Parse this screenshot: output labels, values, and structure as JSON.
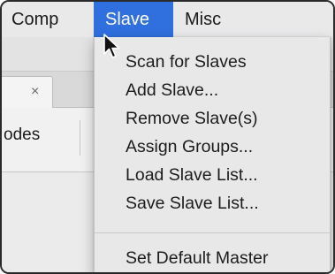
{
  "menubar": {
    "items": [
      {
        "label": "Comp"
      },
      {
        "label": "Slave",
        "active": true
      },
      {
        "label": "Misc"
      }
    ],
    "active_color": "#2f6fde"
  },
  "background": {
    "tab_close_glyph": "×",
    "nodes_label": "odes"
  },
  "dropdown": {
    "items": [
      {
        "label": "Scan for Slaves"
      },
      {
        "label": "Add Slave..."
      },
      {
        "label": "Remove Slave(s)"
      },
      {
        "label": "Assign Groups..."
      },
      {
        "label": "Load Slave List..."
      },
      {
        "label": "Save Slave List..."
      }
    ],
    "footer_item": {
      "label": "Set Default Master"
    }
  },
  "cursor": {
    "icon": "arrow-pointer-icon"
  }
}
